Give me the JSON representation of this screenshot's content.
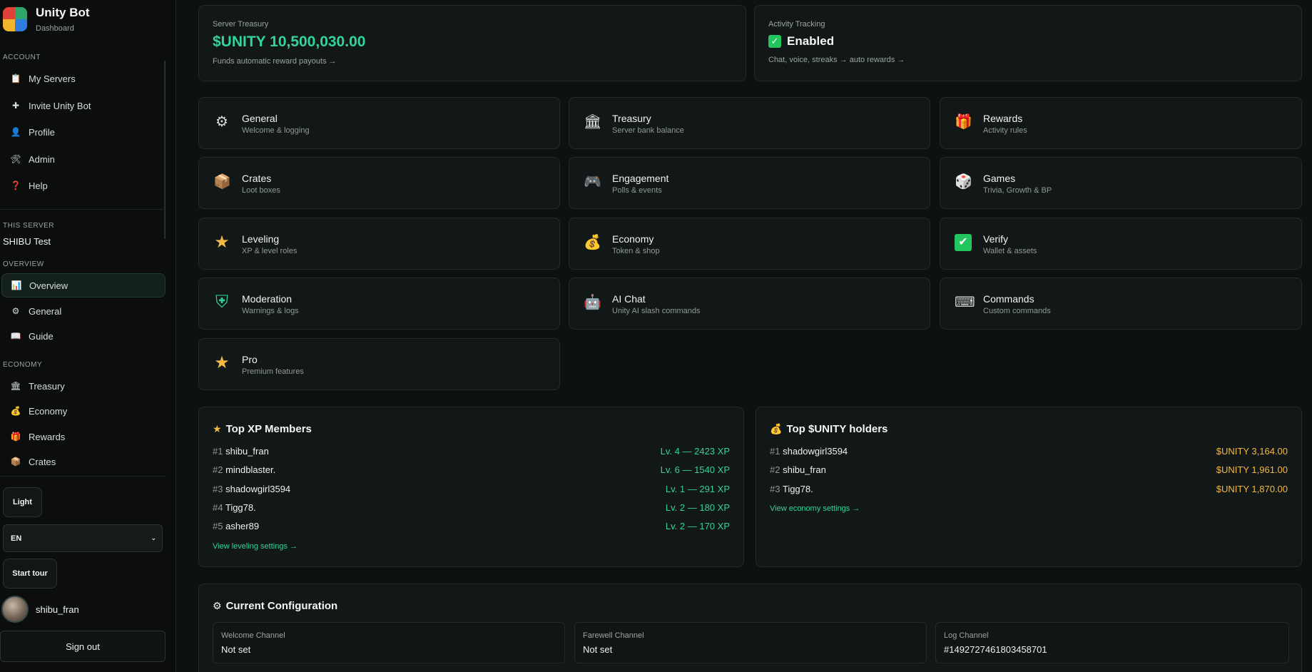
{
  "brand": {
    "title": "Unity Bot",
    "subtitle": "Dashboard"
  },
  "sidebar": {
    "account_label": "ACCOUNT",
    "account_items": [
      {
        "label": "My Servers",
        "icon": "clipboard-icon"
      },
      {
        "label": "Invite Unity Bot",
        "icon": "plus-icon"
      },
      {
        "label": "Profile",
        "icon": "user-icon"
      },
      {
        "label": "Admin",
        "icon": "tools-icon"
      },
      {
        "label": "Help",
        "icon": "question-icon"
      }
    ],
    "this_server_label": "THIS SERVER",
    "server_name": "SHIBU Test",
    "overview_label": "OVERVIEW",
    "overview_items": [
      {
        "label": "Overview",
        "icon": "chart-icon"
      },
      {
        "label": "General",
        "icon": "gear-icon"
      },
      {
        "label": "Guide",
        "icon": "book-icon"
      }
    ],
    "economy_label": "ECONOMY",
    "economy_items": [
      {
        "label": "Treasury",
        "icon": "bank-icon"
      },
      {
        "label": "Economy",
        "icon": "money-bag-icon"
      },
      {
        "label": "Rewards",
        "icon": "gift-icon"
      },
      {
        "label": "Crates",
        "icon": "box-icon"
      }
    ],
    "theme_button": "Light",
    "language": "EN",
    "tour_button": "Start tour",
    "username": "shibu_fran",
    "signout": "Sign out"
  },
  "treasury": {
    "label": "Server Treasury",
    "value": "$UNITY 10,500,030.00",
    "sub": "Funds automatic reward payouts →"
  },
  "activity": {
    "label": "Activity Tracking",
    "status": "Enabled",
    "sub": "Chat, voice, streaks → auto rewards →"
  },
  "features": [
    {
      "title": "General",
      "sub": "Welcome & logging",
      "icon": "gear-icon",
      "glyph": "⚙"
    },
    {
      "title": "Treasury",
      "sub": "Server bank balance",
      "icon": "bank-icon",
      "glyph": "🏛"
    },
    {
      "title": "Rewards",
      "sub": "Activity rules",
      "icon": "gift-icon",
      "glyph": "🎁"
    },
    {
      "title": "Crates",
      "sub": "Loot boxes",
      "icon": "box-icon",
      "glyph": "📦"
    },
    {
      "title": "Engagement",
      "sub": "Polls & events",
      "icon": "gamepad-icon",
      "glyph": "🎮"
    },
    {
      "title": "Games",
      "sub": "Trivia, Growth & BP",
      "icon": "dice-icon",
      "glyph": "🎲"
    },
    {
      "title": "Leveling",
      "sub": "XP & level roles",
      "icon": "star-icon",
      "glyph": "★"
    },
    {
      "title": "Economy",
      "sub": "Token & shop",
      "icon": "money-bag-icon",
      "glyph": "💰"
    },
    {
      "title": "Verify",
      "sub": "Wallet & assets",
      "icon": "check-icon",
      "glyph": "✔"
    },
    {
      "title": "Moderation",
      "sub": "Warnings & logs",
      "icon": "shield-icon",
      "glyph": "⛨"
    },
    {
      "title": "AI Chat",
      "sub": "Unity AI slash commands",
      "icon": "robot-icon",
      "glyph": "🤖"
    },
    {
      "title": "Commands",
      "sub": "Custom commands",
      "icon": "keyboard-icon",
      "glyph": "⌨"
    },
    {
      "title": "Pro",
      "sub": "Premium features",
      "icon": "star-icon",
      "glyph": "★"
    }
  ],
  "xp_panel": {
    "title": "Top XP Members",
    "rows": [
      {
        "rank": "#1",
        "name": "shibu_fran",
        "value": "Lv. 4 — 2423 XP"
      },
      {
        "rank": "#2",
        "name": "mindblaster.",
        "value": "Lv. 6 — 1540 XP"
      },
      {
        "rank": "#3",
        "name": "shadowgirl3594",
        "value": "Lv. 1 — 291 XP"
      },
      {
        "rank": "#4",
        "name": "Tigg78.",
        "value": "Lv. 2 — 180 XP"
      },
      {
        "rank": "#5",
        "name": "asher89",
        "value": "Lv. 2 — 170 XP"
      }
    ],
    "link": "View leveling settings →"
  },
  "holders_panel": {
    "title": "Top $UNITY holders",
    "rows": [
      {
        "rank": "#1",
        "name": "shadowgirl3594",
        "value": "$UNITY 3,164.00"
      },
      {
        "rank": "#2",
        "name": "shibu_fran",
        "value": "$UNITY 1,961.00"
      },
      {
        "rank": "#3",
        "name": "Tigg78.",
        "value": "$UNITY 1,870.00"
      }
    ],
    "link": "View economy settings →"
  },
  "config": {
    "title": "Current Configuration",
    "items": [
      {
        "label": "Welcome Channel",
        "value": "Not set"
      },
      {
        "label": "Farewell Channel",
        "value": "Not set"
      },
      {
        "label": "Log Channel",
        "value": "#1492727461803458701"
      }
    ]
  }
}
